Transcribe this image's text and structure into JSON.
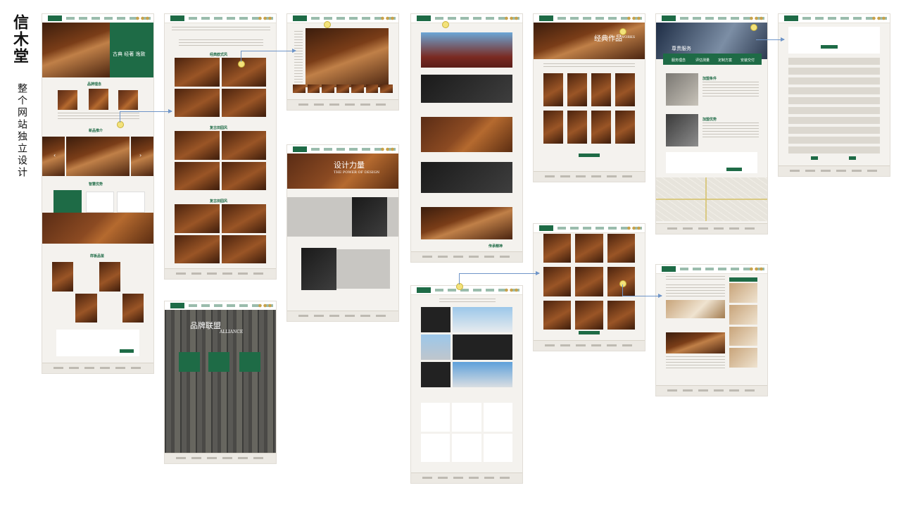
{
  "brand": "信木堂",
  "subtitle": "整个网站独立设计",
  "icons": {
    "prev": "chevron-left-icon",
    "next": "chevron-right-icon"
  },
  "colors": {
    "brand_green": "#1e6b46",
    "wood": "#8b4a22",
    "arrow": "#6f95c8",
    "hotspot": "#f3e27a"
  },
  "home": {
    "hero_tagline": "古典 经著 逸致",
    "sec_concept": "品牌理念",
    "sec_products": "新品推介",
    "sec_service": "智慧优势",
    "sec_craft": "工匠精神",
    "sec_cases": "样板品鉴"
  },
  "products": {
    "sec_1": "经典欧式风",
    "sec_2": "复古田园风",
    "sec_3": "复古田园风"
  },
  "alliance": {
    "title": "品牌联盟",
    "subtitle": "ALLIANCE"
  },
  "design": {
    "title": "设计力量",
    "subtitle": "THE POWER OF DESIGN"
  },
  "factory": {
    "caption": "传承精神"
  },
  "works": {
    "title": "经典作品",
    "subtitle": "WORKS"
  },
  "services": {
    "hero_title": "尊贵服务",
    "steps": [
      "服务理念",
      "评估测量",
      "定制方案",
      "安装交付"
    ],
    "sec_1": "加盟条件",
    "sec_2": "加盟优势"
  }
}
